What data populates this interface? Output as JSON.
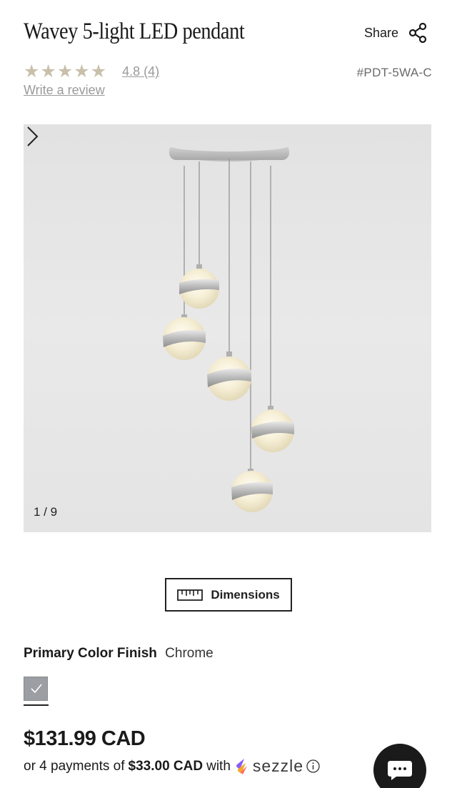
{
  "product": {
    "title": "Wavey 5-light LED pendant",
    "share_label": "Share",
    "rating_text": "4.8 (4)",
    "stars": 5,
    "sku": "#PDT-5WA-C",
    "write_review": "Write a review"
  },
  "gallery": {
    "counter": "1 / 9"
  },
  "dimensions": {
    "label": "Dimensions"
  },
  "finish": {
    "label": "Primary Color Finish",
    "value": "Chrome",
    "swatch_color": "#9b9ea3"
  },
  "pricing": {
    "price": "$131.99 CAD",
    "installments_prefix": "or 4 payments of",
    "installment_amount": "$33.00 CAD",
    "installments_with": "with",
    "provider": "sezzle"
  },
  "icons": {
    "share": "share-icon",
    "next": "chevron-right-icon",
    "ruler": "ruler-icon",
    "check": "check-icon",
    "info": "info-icon",
    "chat": "chat-bubble-icon"
  },
  "colors": {
    "text": "#1a1a1a",
    "muted": "#9a9a9a",
    "star": "#c8c0aa",
    "chat_button": "#1a1a1a"
  }
}
